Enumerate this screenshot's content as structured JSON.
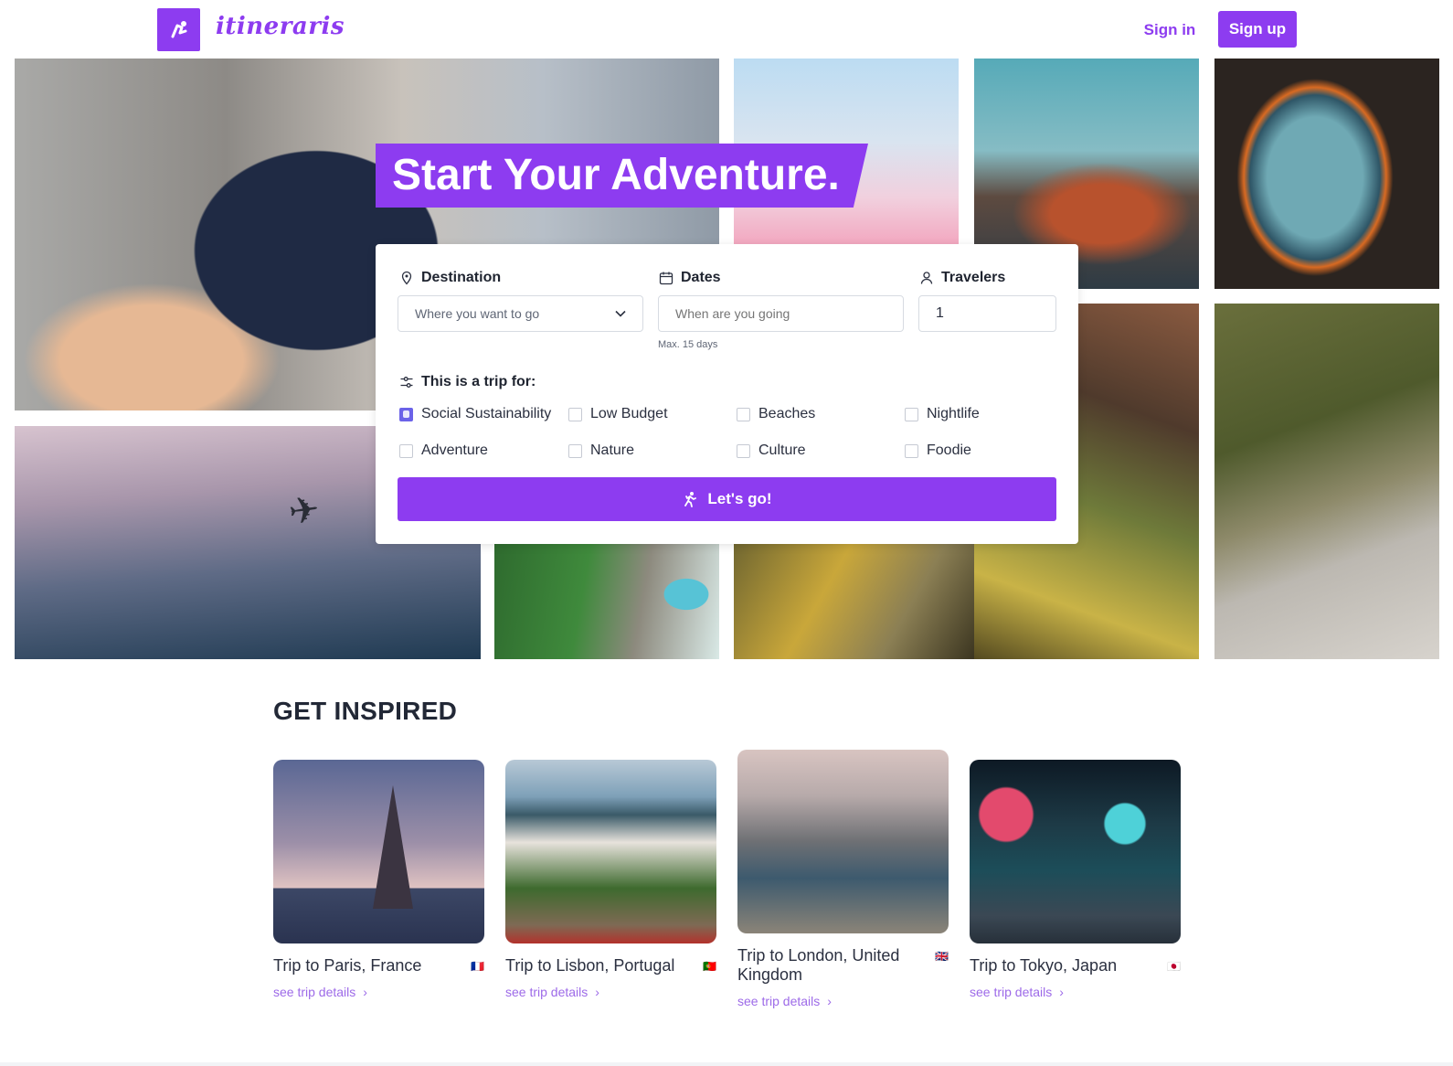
{
  "brand": {
    "name": "itineraris",
    "accent": "#8d3cf0"
  },
  "header": {
    "signin_label": "Sign in",
    "signup_label": "Sign up"
  },
  "hero": {
    "headline": "Start Your Adventure."
  },
  "search": {
    "destination": {
      "label": "Destination",
      "placeholder": "Where you want to go",
      "icon": "location-pin-icon"
    },
    "dates": {
      "label": "Dates",
      "placeholder": "When are you going",
      "hint": "Max. 15 days",
      "icon": "calendar-icon"
    },
    "travelers": {
      "label": "Travelers",
      "value": "1",
      "icon": "person-icon"
    },
    "trip_for": {
      "label": "This is a trip for:",
      "icon": "sliders-icon",
      "options": [
        {
          "label": "Social Sustainability",
          "checked": true
        },
        {
          "label": "Low Budget",
          "checked": false
        },
        {
          "label": "Beaches",
          "checked": false
        },
        {
          "label": "Nightlife",
          "checked": false
        },
        {
          "label": "Adventure",
          "checked": false
        },
        {
          "label": "Nature",
          "checked": false
        },
        {
          "label": "Culture",
          "checked": false
        },
        {
          "label": "Foodie",
          "checked": false
        }
      ]
    },
    "submit_label": "Let's go!",
    "submit_icon": "hiker-icon"
  },
  "inspired": {
    "title": "GET INSPIRED",
    "trips": [
      {
        "name": "Trip to Paris, France",
        "flag": "🇫🇷",
        "link": "see trip details"
      },
      {
        "name": "Trip to Lisbon, Portugal",
        "flag": "🇵🇹",
        "link": "see trip details"
      },
      {
        "name": "Trip to London, United Kingdom",
        "flag": "🇬🇧",
        "link": "see trip details"
      },
      {
        "name": "Trip to Tokyo, Japan",
        "flag": "🇯🇵",
        "link": "see trip details"
      }
    ]
  }
}
